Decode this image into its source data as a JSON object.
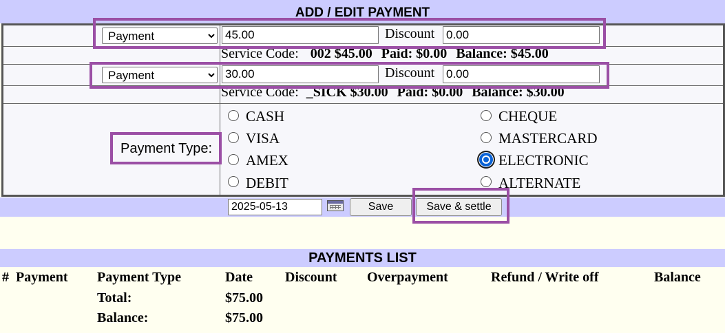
{
  "header": {
    "title": "ADD / EDIT PAYMENT"
  },
  "payments": [
    {
      "type_selected": "Payment",
      "amount": "45.00",
      "discount_label": "Discount",
      "discount_value": "0.00",
      "service_label": "Service Code:",
      "service_code": "002 $45.00",
      "paid": "Paid: $0.00",
      "balance": "Balance: $45.00"
    },
    {
      "type_selected": "Payment",
      "amount": "30.00",
      "discount_label": "Discount",
      "discount_value": "0.00",
      "service_label": "Service Code:",
      "service_code": "_SICK $30.00",
      "paid": "Paid: $0.00",
      "balance": "Balance: $30.00"
    }
  ],
  "payment_type": {
    "label": "Payment Type:",
    "options": [
      "CASH",
      "CHEQUE",
      "VISA",
      "MASTERCARD",
      "AMEX",
      "ELECTRONIC",
      "DEBIT",
      "ALTERNATE"
    ],
    "selected": "ELECTRONIC"
  },
  "actions": {
    "date": "2025-05-13",
    "calendar_icon": "calendar-icon",
    "save_label": "Save",
    "save_settle_label": "Save & settle"
  },
  "payments_list": {
    "title": "PAYMENTS LIST",
    "columns": [
      "#",
      "Payment",
      "Payment Type",
      "Date",
      "Discount",
      "Overpayment",
      "Refund / Write off",
      "Balance"
    ],
    "total_label": "Total:",
    "total_value": "$75.00",
    "balance_label": "Balance:",
    "balance_value": "$75.00"
  },
  "colors": {
    "header_bg": "#ccccff",
    "page_bg": "#fffff0",
    "highlight": "#9b4fa5",
    "radio_selected": "#0b63d6"
  }
}
